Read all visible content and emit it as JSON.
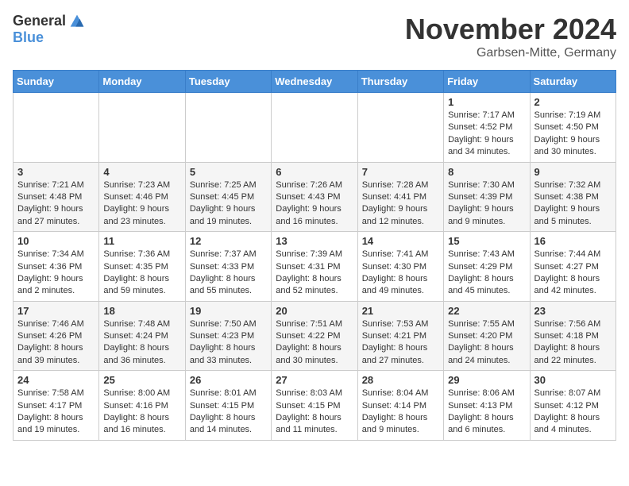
{
  "logo": {
    "general": "General",
    "blue": "Blue"
  },
  "title": "November 2024",
  "subtitle": "Garbsen-Mitte, Germany",
  "headers": [
    "Sunday",
    "Monday",
    "Tuesday",
    "Wednesday",
    "Thursday",
    "Friday",
    "Saturday"
  ],
  "weeks": [
    [
      {
        "day": "",
        "info": ""
      },
      {
        "day": "",
        "info": ""
      },
      {
        "day": "",
        "info": ""
      },
      {
        "day": "",
        "info": ""
      },
      {
        "day": "",
        "info": ""
      },
      {
        "day": "1",
        "info": "Sunrise: 7:17 AM\nSunset: 4:52 PM\nDaylight: 9 hours and 34 minutes."
      },
      {
        "day": "2",
        "info": "Sunrise: 7:19 AM\nSunset: 4:50 PM\nDaylight: 9 hours and 30 minutes."
      }
    ],
    [
      {
        "day": "3",
        "info": "Sunrise: 7:21 AM\nSunset: 4:48 PM\nDaylight: 9 hours and 27 minutes."
      },
      {
        "day": "4",
        "info": "Sunrise: 7:23 AM\nSunset: 4:46 PM\nDaylight: 9 hours and 23 minutes."
      },
      {
        "day": "5",
        "info": "Sunrise: 7:25 AM\nSunset: 4:45 PM\nDaylight: 9 hours and 19 minutes."
      },
      {
        "day": "6",
        "info": "Sunrise: 7:26 AM\nSunset: 4:43 PM\nDaylight: 9 hours and 16 minutes."
      },
      {
        "day": "7",
        "info": "Sunrise: 7:28 AM\nSunset: 4:41 PM\nDaylight: 9 hours and 12 minutes."
      },
      {
        "day": "8",
        "info": "Sunrise: 7:30 AM\nSunset: 4:39 PM\nDaylight: 9 hours and 9 minutes."
      },
      {
        "day": "9",
        "info": "Sunrise: 7:32 AM\nSunset: 4:38 PM\nDaylight: 9 hours and 5 minutes."
      }
    ],
    [
      {
        "day": "10",
        "info": "Sunrise: 7:34 AM\nSunset: 4:36 PM\nDaylight: 9 hours and 2 minutes."
      },
      {
        "day": "11",
        "info": "Sunrise: 7:36 AM\nSunset: 4:35 PM\nDaylight: 8 hours and 59 minutes."
      },
      {
        "day": "12",
        "info": "Sunrise: 7:37 AM\nSunset: 4:33 PM\nDaylight: 8 hours and 55 minutes."
      },
      {
        "day": "13",
        "info": "Sunrise: 7:39 AM\nSunset: 4:31 PM\nDaylight: 8 hours and 52 minutes."
      },
      {
        "day": "14",
        "info": "Sunrise: 7:41 AM\nSunset: 4:30 PM\nDaylight: 8 hours and 49 minutes."
      },
      {
        "day": "15",
        "info": "Sunrise: 7:43 AM\nSunset: 4:29 PM\nDaylight: 8 hours and 45 minutes."
      },
      {
        "day": "16",
        "info": "Sunrise: 7:44 AM\nSunset: 4:27 PM\nDaylight: 8 hours and 42 minutes."
      }
    ],
    [
      {
        "day": "17",
        "info": "Sunrise: 7:46 AM\nSunset: 4:26 PM\nDaylight: 8 hours and 39 minutes."
      },
      {
        "day": "18",
        "info": "Sunrise: 7:48 AM\nSunset: 4:24 PM\nDaylight: 8 hours and 36 minutes."
      },
      {
        "day": "19",
        "info": "Sunrise: 7:50 AM\nSunset: 4:23 PM\nDaylight: 8 hours and 33 minutes."
      },
      {
        "day": "20",
        "info": "Sunrise: 7:51 AM\nSunset: 4:22 PM\nDaylight: 8 hours and 30 minutes."
      },
      {
        "day": "21",
        "info": "Sunrise: 7:53 AM\nSunset: 4:21 PM\nDaylight: 8 hours and 27 minutes."
      },
      {
        "day": "22",
        "info": "Sunrise: 7:55 AM\nSunset: 4:20 PM\nDaylight: 8 hours and 24 minutes."
      },
      {
        "day": "23",
        "info": "Sunrise: 7:56 AM\nSunset: 4:18 PM\nDaylight: 8 hours and 22 minutes."
      }
    ],
    [
      {
        "day": "24",
        "info": "Sunrise: 7:58 AM\nSunset: 4:17 PM\nDaylight: 8 hours and 19 minutes."
      },
      {
        "day": "25",
        "info": "Sunrise: 8:00 AM\nSunset: 4:16 PM\nDaylight: 8 hours and 16 minutes."
      },
      {
        "day": "26",
        "info": "Sunrise: 8:01 AM\nSunset: 4:15 PM\nDaylight: 8 hours and 14 minutes."
      },
      {
        "day": "27",
        "info": "Sunrise: 8:03 AM\nSunset: 4:15 PM\nDaylight: 8 hours and 11 minutes."
      },
      {
        "day": "28",
        "info": "Sunrise: 8:04 AM\nSunset: 4:14 PM\nDaylight: 8 hours and 9 minutes."
      },
      {
        "day": "29",
        "info": "Sunrise: 8:06 AM\nSunset: 4:13 PM\nDaylight: 8 hours and 6 minutes."
      },
      {
        "day": "30",
        "info": "Sunrise: 8:07 AM\nSunset: 4:12 PM\nDaylight: 8 hours and 4 minutes."
      }
    ]
  ]
}
